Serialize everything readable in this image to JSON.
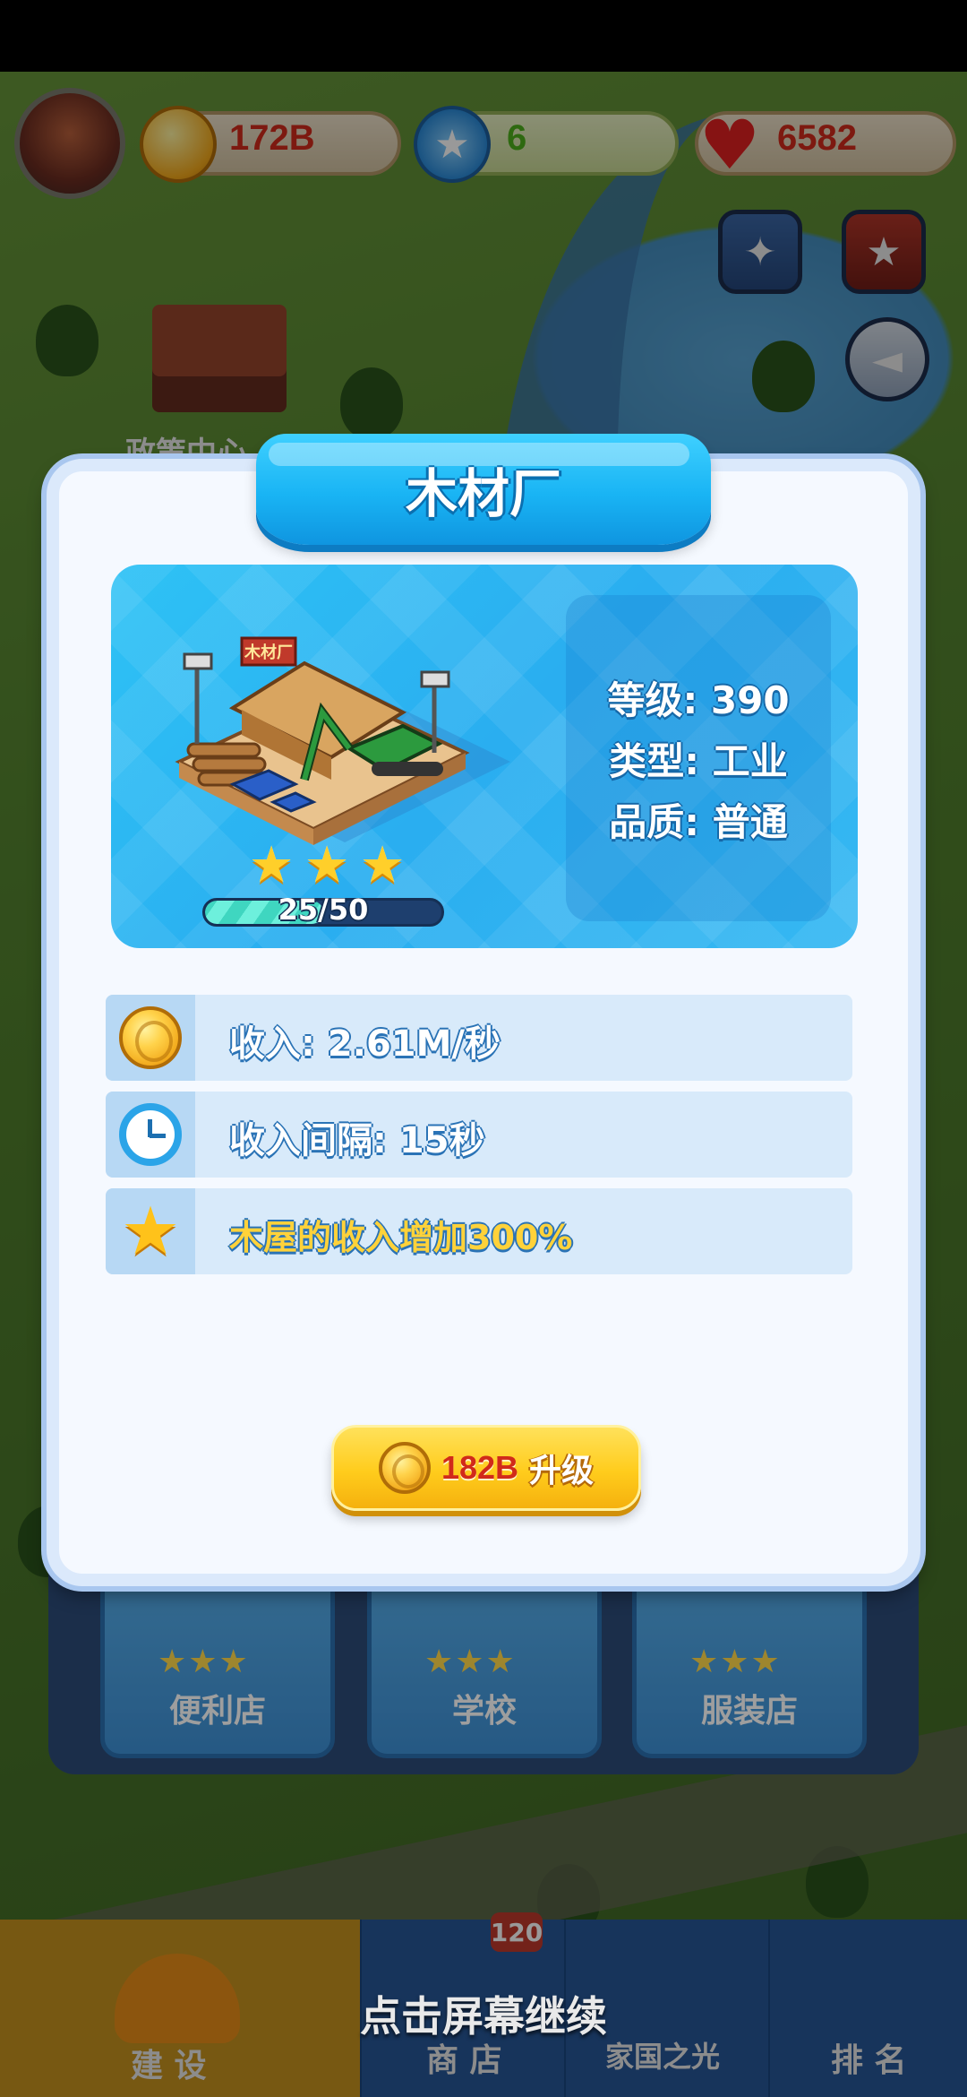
{
  "hud": {
    "coins": "172B",
    "stars": "6",
    "hearts": "6582"
  },
  "dialog": {
    "title": "木材厂",
    "building_sign": "木材厂",
    "level": "等级: 390",
    "type": "类型: 工业",
    "quality": "品质: 普通",
    "star_count": 3,
    "progress_text": "25/50",
    "progress_fraction": 0.5,
    "stats": [
      {
        "icon": "coin-icon",
        "text": "收入: 2.61M/秒"
      },
      {
        "icon": "clock-icon",
        "text": "收入间隔: 15秒"
      },
      {
        "icon": "star-icon",
        "text": "木屋的收入增加300%"
      }
    ],
    "upgrade": {
      "cost": "182B",
      "label": "升级"
    }
  },
  "under_list": {
    "items": [
      {
        "label": "便利店"
      },
      {
        "label": "学校"
      },
      {
        "label": "服装店"
      }
    ]
  },
  "partial_labels": {
    "policy_center": "政策中心"
  },
  "bottom_nav": {
    "tabs": [
      {
        "label": "建 设"
      },
      {
        "label": "商 店"
      },
      {
        "label": "家国之光"
      },
      {
        "label": "排 名"
      }
    ],
    "badge": "120"
  },
  "prompt": "点击屏幕继续",
  "colors": {
    "banner_blue": "#19b4f4",
    "coin_text": "#d12a1a",
    "star_text": "#4caf1a",
    "heart_text": "#d12a1a",
    "button_yellow": "#ffcc1c"
  }
}
